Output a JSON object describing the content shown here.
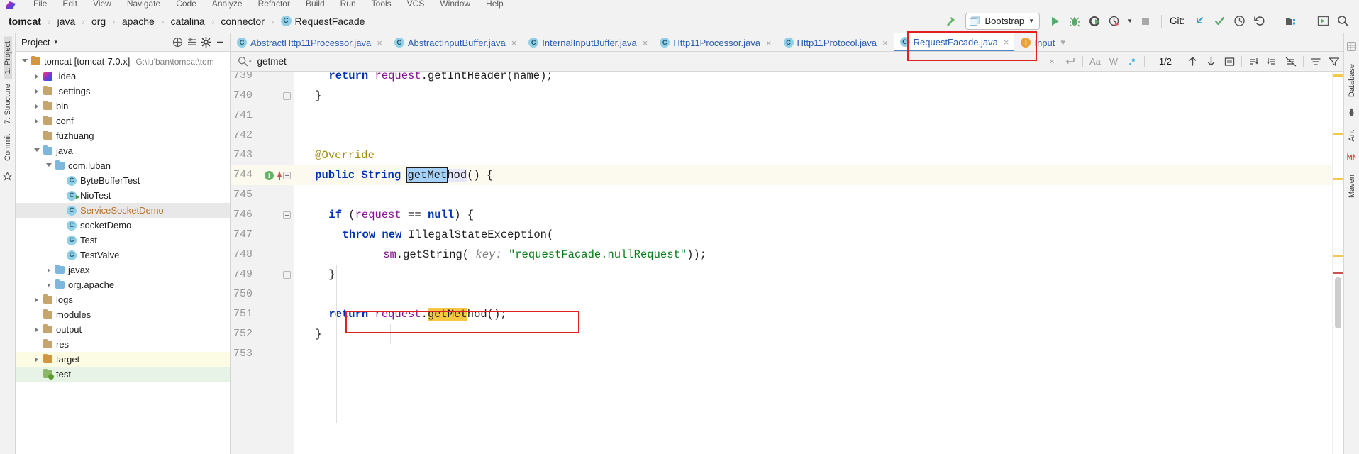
{
  "menu": {
    "items": [
      "File",
      "Edit",
      "View",
      "Navigate",
      "Code",
      "Analyze",
      "Refactor",
      "Build",
      "Run",
      "Tools",
      "VCS",
      "Window",
      "Help"
    ]
  },
  "breadcrumb": {
    "items": [
      "tomcat",
      "java",
      "org",
      "apache",
      "catalina",
      "connector"
    ],
    "separator": "›",
    "file": "RequestFacade",
    "file_badge": "C"
  },
  "toolbar": {
    "build_icon": "hammer-icon",
    "run_config": {
      "label": "Bootstrap",
      "icon": "run-config-icon",
      "chevron": "▼"
    },
    "run_icon": "run-icon",
    "debug_icon": "debug-icon",
    "run_coverage_icon": "run-with-coverage-icon",
    "profiler_icon": "profiler-icon",
    "profiler_chevron": "▼",
    "stop_icon": "stop-icon",
    "git_label": "Git:",
    "git_update_icon": "update-project-icon",
    "git_commit_icon": "commit-icon",
    "git_history_icon": "history-icon",
    "git_rollback_icon": "rollback-icon",
    "project_structure_icon": "project-structure-icon",
    "run_anything_icon": "run-anything-icon",
    "search_everywhere_icon": "search-everywhere-icon"
  },
  "left_strip": {
    "project_label": "1: Project",
    "structure_label": "7: Structure",
    "commit_label": "Commit",
    "favorites_icon": "favorites-icon"
  },
  "right_strip": {
    "database_label": "Database",
    "ant_label": "Ant",
    "maven_label": "Maven"
  },
  "project_panel": {
    "title": "Project",
    "title_chevron": "▾",
    "collapse_icon": "collapse-all-icon",
    "locate_icon": "select-opened-file-icon",
    "settings_icon": "gear-icon",
    "hide_icon": "hide-icon",
    "tree": [
      {
        "label": "tomcat [tomcat-7.0.x]",
        "suffix": "G:\\lu'ban\\tomcat\\tom",
        "depth": 0,
        "icon": "folder-module",
        "arrow": "open",
        "highlight": "none"
      },
      {
        "label": ".idea",
        "depth": 1,
        "icon": "folder-idea",
        "arrow": "closed",
        "highlight": "none"
      },
      {
        "label": ".settings",
        "depth": 1,
        "icon": "folder-plain",
        "arrow": "closed",
        "highlight": "none"
      },
      {
        "label": "bin",
        "depth": 1,
        "icon": "folder-plain",
        "arrow": "closed",
        "highlight": "none"
      },
      {
        "label": "conf",
        "depth": 1,
        "icon": "folder-plain",
        "arrow": "closed",
        "highlight": "none"
      },
      {
        "label": "fuzhuang",
        "depth": 1,
        "icon": "folder-plain",
        "arrow": "none",
        "highlight": "none"
      },
      {
        "label": "java",
        "depth": 1,
        "icon": "folder-source",
        "arrow": "open",
        "highlight": "none"
      },
      {
        "label": "com.luban",
        "depth": 2,
        "icon": "folder-package",
        "arrow": "open",
        "highlight": "none"
      },
      {
        "label": "ByteBufferTest",
        "depth": 3,
        "icon": "java-class",
        "arrow": "none",
        "highlight": "none"
      },
      {
        "label": "NioTest",
        "depth": 3,
        "icon": "java-class-run",
        "arrow": "none",
        "highlight": "none"
      },
      {
        "label": "ServiceSocketDemo",
        "depth": 3,
        "icon": "java-class",
        "arrow": "none",
        "highlight": "selected"
      },
      {
        "label": "socketDemo",
        "depth": 3,
        "icon": "java-class",
        "arrow": "none",
        "highlight": "none"
      },
      {
        "label": "Test",
        "depth": 3,
        "icon": "java-class",
        "arrow": "none",
        "highlight": "none"
      },
      {
        "label": "TestValve",
        "depth": 3,
        "icon": "java-class",
        "arrow": "none",
        "highlight": "none"
      },
      {
        "label": "javax",
        "depth": 2,
        "icon": "folder-package",
        "arrow": "closed",
        "highlight": "none"
      },
      {
        "label": "org.apache",
        "depth": 2,
        "icon": "folder-package",
        "arrow": "closed",
        "highlight": "none"
      },
      {
        "label": "logs",
        "depth": 1,
        "icon": "folder-plain",
        "arrow": "closed",
        "highlight": "none"
      },
      {
        "label": "modules",
        "depth": 1,
        "icon": "folder-plain",
        "arrow": "none",
        "highlight": "none"
      },
      {
        "label": "output",
        "depth": 1,
        "icon": "folder-plain",
        "arrow": "closed",
        "highlight": "none"
      },
      {
        "label": "res",
        "depth": 1,
        "icon": "folder-plain",
        "arrow": "none",
        "highlight": "none"
      },
      {
        "label": "target",
        "depth": 1,
        "icon": "folder-target",
        "arrow": "closed",
        "highlight": "yellow"
      },
      {
        "label": "test",
        "depth": 1,
        "icon": "folder-test",
        "arrow": "none",
        "highlight": "green"
      }
    ]
  },
  "tabs": [
    {
      "label": "AbstractHttp11Processor.java",
      "badge": "C",
      "active": false,
      "close": "×"
    },
    {
      "label": "AbstractInputBuffer.java",
      "badge": "C",
      "active": false,
      "close": "×"
    },
    {
      "label": "InternalInputBuffer.java",
      "badge": "C",
      "active": false,
      "close": "×"
    },
    {
      "label": "Http11Processor.java",
      "badge": "C",
      "active": false,
      "close": "×"
    },
    {
      "label": "Http11Protocol.java",
      "badge": "C",
      "active": false,
      "close": "×"
    },
    {
      "label": "RequestFacade.java",
      "badge": "C",
      "active": true,
      "close": "×"
    },
    {
      "label": "Input",
      "badge": "I",
      "active": false,
      "close": "▾"
    }
  ],
  "search": {
    "icon": "search-icon",
    "dropdown": "▾",
    "value": "getmet",
    "placeholder": "Search",
    "clear": "×",
    "multiline_icon": "multiline-icon",
    "match_case": "Aa",
    "words": "W",
    "regex": ".*",
    "counter": "1/2",
    "prev_icon": "arrow-up-icon",
    "next_icon": "arrow-down-icon",
    "select_all_icon": "select-all-occurrences-icon",
    "filter1_icon": "filter-in-comments-icon",
    "filter2_icon": "filter-in-literals-icon",
    "filter3_icon": "filter-except-comments-icon",
    "scope_icon": "scope-icon",
    "filter_icon": "filter-icon"
  },
  "code": {
    "lines": [
      {
        "num": "739",
        "indent": 2,
        "highlight": false,
        "tokens": [
          {
            "t": "return",
            "c": "k"
          },
          {
            "t": " ",
            "c": "p"
          },
          {
            "t": "request",
            "c": "f"
          },
          {
            "t": ".getIntHeader(name);",
            "c": "p"
          }
        ]
      },
      {
        "num": "740",
        "indent": 1,
        "highlight": false,
        "fold": true,
        "tokens": [
          {
            "t": "}",
            "c": "p"
          }
        ]
      },
      {
        "num": "741",
        "indent": 0,
        "highlight": false,
        "tokens": []
      },
      {
        "num": "742",
        "indent": 0,
        "highlight": false,
        "tokens": []
      },
      {
        "num": "743",
        "indent": 1,
        "highlight": false,
        "tokens": [
          {
            "t": "@Override",
            "c": "a"
          }
        ]
      },
      {
        "num": "744",
        "indent": 1,
        "highlight": true,
        "fold": true,
        "gbadge": "I",
        "garrow": true,
        "tokens": [
          {
            "t": "public",
            "c": "k"
          },
          {
            "t": " ",
            "c": "p"
          },
          {
            "t": "String",
            "c": "k"
          },
          {
            "t": " ",
            "c": "p"
          },
          {
            "t": "getMet",
            "c": "sel-box"
          },
          {
            "t": "hod",
            "c": "occ"
          },
          {
            "t": "() {",
            "c": "p"
          }
        ]
      },
      {
        "num": "745",
        "indent": 0,
        "highlight": false,
        "tokens": []
      },
      {
        "num": "746",
        "indent": 2,
        "highlight": false,
        "fold": true,
        "tokens": [
          {
            "t": "if",
            "c": "k"
          },
          {
            "t": " (",
            "c": "p"
          },
          {
            "t": "request",
            "c": "f"
          },
          {
            "t": " == ",
            "c": "p"
          },
          {
            "t": "null",
            "c": "k"
          },
          {
            "t": ") {",
            "c": "p"
          }
        ]
      },
      {
        "num": "747",
        "indent": 3,
        "highlight": false,
        "tokens": [
          {
            "t": "throw",
            "c": "k"
          },
          {
            "t": " ",
            "c": "p"
          },
          {
            "t": "new",
            "c": "k"
          },
          {
            "t": " IllegalStateException(",
            "c": "p"
          }
        ]
      },
      {
        "num": "748",
        "indent": 6,
        "highlight": false,
        "tokens": [
          {
            "t": "sm",
            "c": "f"
          },
          {
            "t": ".getString( ",
            "c": "p"
          },
          {
            "t": "key:",
            "c": "hint"
          },
          {
            "t": " ",
            "c": "p"
          },
          {
            "t": "\"requestFacade.nullRequest\"",
            "c": "s"
          },
          {
            "t": "));",
            "c": "p"
          }
        ]
      },
      {
        "num": "749",
        "indent": 2,
        "highlight": false,
        "fold": true,
        "tokens": [
          {
            "t": "}",
            "c": "p"
          }
        ]
      },
      {
        "num": "750",
        "indent": 0,
        "highlight": false,
        "tokens": []
      },
      {
        "num": "751",
        "indent": 2,
        "highlight": false,
        "boxed": true,
        "tokens": [
          {
            "t": "return",
            "c": "k"
          },
          {
            "t": " ",
            "c": "p"
          },
          {
            "t": "request",
            "c": "f"
          },
          {
            "t": ".",
            "c": "p"
          },
          {
            "t": "getMet",
            "c": "occ2"
          },
          {
            "t": "hod();",
            "c": "p"
          }
        ]
      },
      {
        "num": "752",
        "indent": 1,
        "highlight": false,
        "tokens": [
          {
            "t": "}",
            "c": "p"
          }
        ]
      },
      {
        "num": "753",
        "indent": 0,
        "highlight": false,
        "tokens": []
      }
    ]
  },
  "colors": {
    "accent_blue": "#2a5db0",
    "annotation_red": "#e02020",
    "keyword": "#0033b3",
    "string": "#067d17",
    "field": "#871094",
    "annotation_gold": "#9e880d",
    "highlight_line": "#fcfaef",
    "selection": "#a6d2fa",
    "occurrence": "#f5c842"
  }
}
